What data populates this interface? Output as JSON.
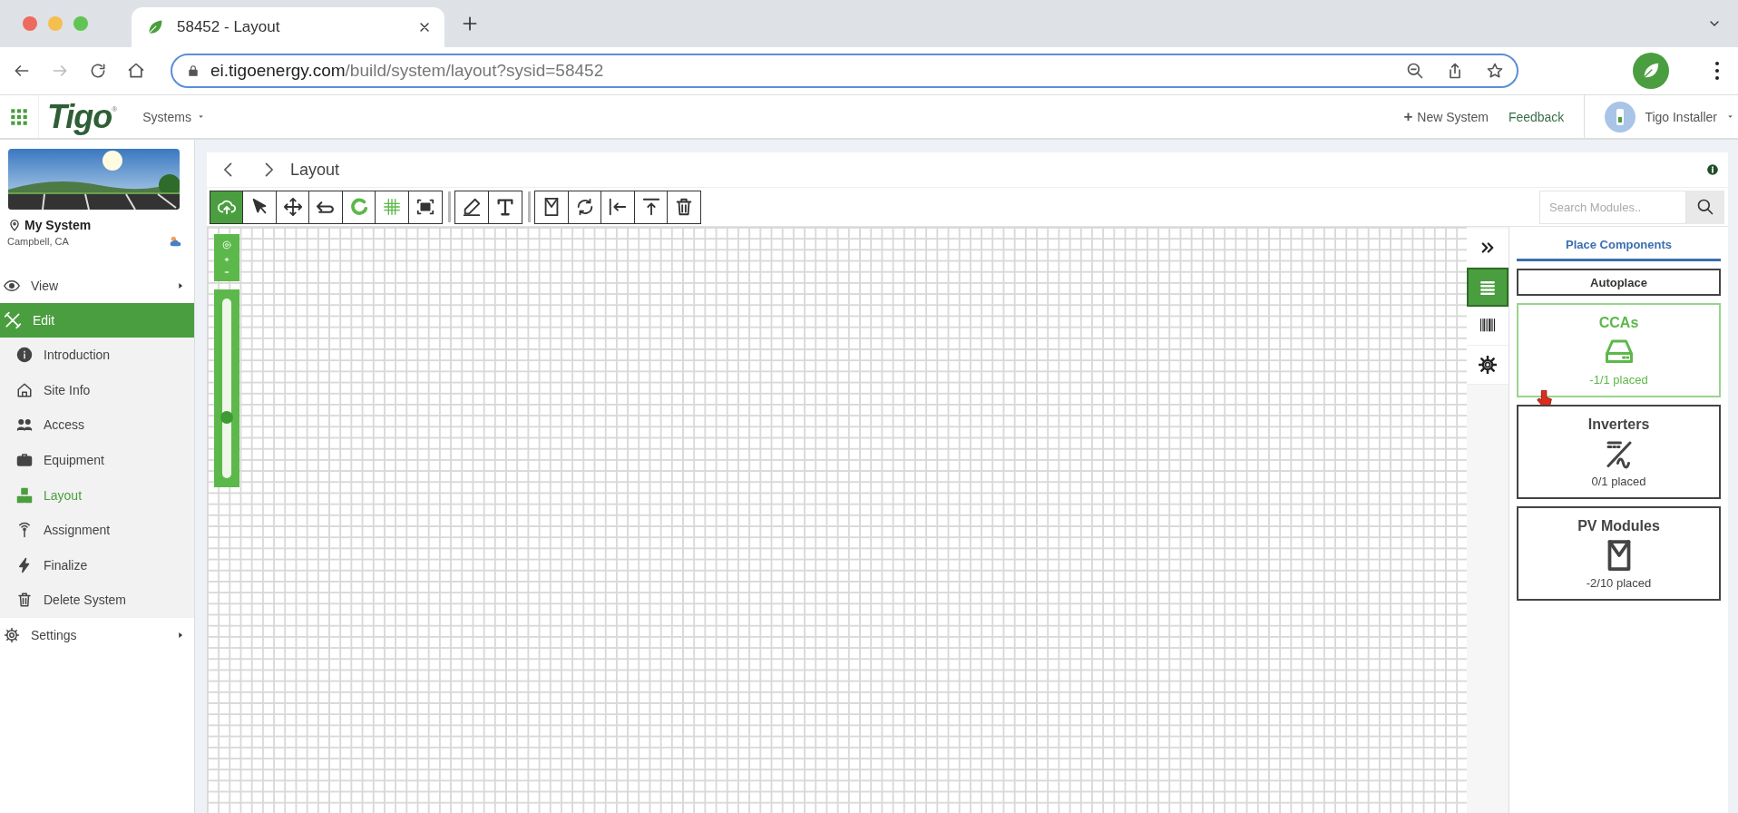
{
  "browser": {
    "tab_title": "58452 - Layout",
    "url_host": "ei.tigoenergy.com",
    "url_path": "/build/system/layout?sysid=58452",
    "forward_disabled": true
  },
  "header": {
    "logo": "Tigo",
    "logo_mark": "®",
    "systems_menu": "Systems",
    "new_system": "New System",
    "new_system_icon": "+",
    "feedback": "Feedback",
    "user": "Tigo Installer"
  },
  "sidebar": {
    "system_name": "My System",
    "location": "Campbell, CA",
    "items": [
      {
        "kind": "view",
        "label": "View",
        "selected": false,
        "arrow": true
      },
      {
        "kind": "edit",
        "label": "Edit",
        "selected": true,
        "arrow": false,
        "children": [
          {
            "kind": "info",
            "label": "Introduction",
            "selected": false
          },
          {
            "kind": "house",
            "label": "Site Info",
            "selected": false
          },
          {
            "kind": "people",
            "label": "Access",
            "selected": false
          },
          {
            "kind": "briefcase",
            "label": "Equipment",
            "selected": false
          },
          {
            "kind": "layout",
            "label": "Layout",
            "selected": true
          },
          {
            "kind": "antenna",
            "label": "Assignment",
            "selected": false
          },
          {
            "kind": "bolt",
            "label": "Finalize",
            "selected": false
          },
          {
            "kind": "trash",
            "label": "Delete System",
            "selected": false
          }
        ]
      },
      {
        "kind": "gear",
        "label": "Settings",
        "selected": false,
        "arrow": true
      }
    ]
  },
  "panel": {
    "title": "Layout",
    "toolbar": [
      [
        {
          "kind": "upload",
          "selected": true,
          "on": false
        },
        {
          "kind": "pointer",
          "selected": false,
          "on": false
        },
        {
          "kind": "move",
          "selected": false,
          "on": false
        },
        {
          "kind": "undo",
          "selected": false,
          "on": false
        },
        {
          "kind": "magnet",
          "selected": false,
          "on": true
        },
        {
          "kind": "grid",
          "selected": false,
          "on": true
        },
        {
          "kind": "fit",
          "selected": false,
          "on": false
        }
      ],
      [
        {
          "kind": "pencil",
          "selected": false,
          "on": false
        },
        {
          "kind": "text",
          "selected": false,
          "on": false
        }
      ],
      [
        {
          "kind": "module",
          "selected": false,
          "on": false
        },
        {
          "kind": "rotate",
          "selected": false,
          "on": false
        },
        {
          "kind": "align-left",
          "selected": false,
          "on": false
        },
        {
          "kind": "align-top",
          "selected": false,
          "on": false
        },
        {
          "kind": "trash",
          "selected": false,
          "on": false
        }
      ]
    ],
    "search": {
      "placeholder": "Search Modules.."
    },
    "zoom": {
      "level": 0.34
    },
    "side_tools": [
      {
        "kind": "expand",
        "selected": false
      },
      {
        "kind": "modules",
        "selected": true
      },
      {
        "kind": "barcode",
        "selected": false
      },
      {
        "kind": "gear",
        "selected": false
      }
    ],
    "components": {
      "tab": "Place Components",
      "autoplace": "Autoplace",
      "cards": [
        {
          "kind": "cca",
          "title": "CCAs",
          "count": "-1/1 placed",
          "selected": true
        },
        {
          "kind": "inverter",
          "title": "Inverters",
          "count": "0/1 placed",
          "selected": false
        },
        {
          "kind": "module",
          "title": "PV Modules",
          "count": "-2/10 placed",
          "selected": false
        }
      ]
    }
  }
}
